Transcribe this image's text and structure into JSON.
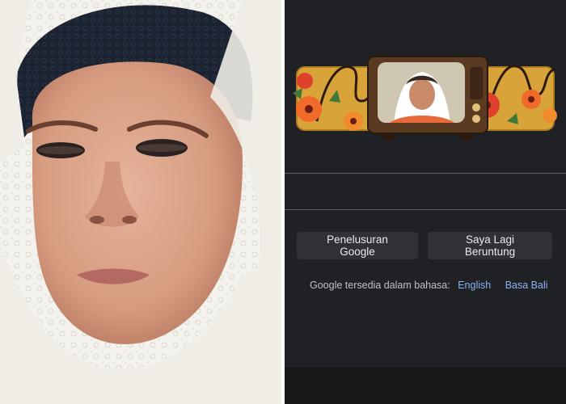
{
  "colors": {
    "page_bg": "#202124",
    "button_bg": "#303134",
    "button_text": "#e8eaed",
    "muted_text": "#bdc1c6",
    "link": "#8ab4f8"
  },
  "left_panel": {
    "photo_subject": "woman-portrait"
  },
  "google": {
    "doodle_icon": "google-doodle-portrait",
    "buttons": {
      "search_label": "Penelusuran Google",
      "lucky_label": "Saya Lagi Beruntung"
    },
    "languages": {
      "intro": "Google tersedia dalam bahasa:",
      "options": [
        "English",
        "Basa Bali"
      ]
    }
  }
}
